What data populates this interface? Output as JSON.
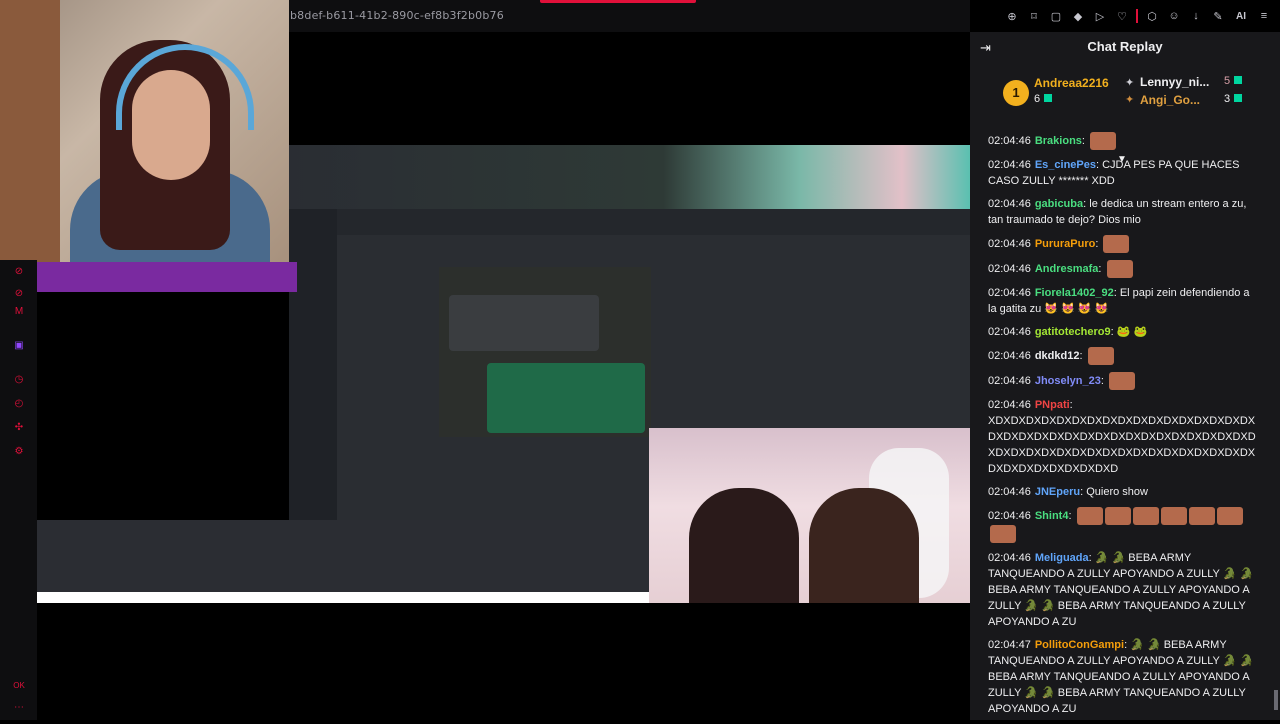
{
  "browser": {
    "url_fragment": "b8def-b611-41b2-890c-ef8b3f2b0b76",
    "toolbar_icons": [
      "zoom-icon",
      "bookmark-icon",
      "screenshot-icon",
      "shield-icon",
      "play-icon",
      "heart-icon",
      "extension-icon",
      "person-icon",
      "download-icon",
      "edit-icon",
      "ai-icon",
      "menu-icon"
    ],
    "ai_label": "AI"
  },
  "rail": {
    "icons": [
      "clip-icon",
      "clip-icon",
      "m-icon",
      "twitch-icon",
      "clock-icon",
      "history-icon",
      "puzzle-icon",
      "settings-icon"
    ],
    "bottom_label": "OK"
  },
  "chat": {
    "title": "Chat Replay",
    "leaderboard": {
      "first": {
        "rank": "1",
        "name": "Andreaa2216",
        "count": "6"
      },
      "second": {
        "name": "Lennyy_ni...",
        "count": "5"
      },
      "third": {
        "name": "Angi_Go...",
        "count": "3"
      }
    },
    "messages": [
      {
        "time": "02:04:46",
        "user": "Brakions",
        "color": "#4ade80",
        "text": "",
        "emotes": 1
      },
      {
        "time": "02:04:46",
        "user": "Es_cinePes",
        "color": "#60a5fa",
        "text": "CJDA PES PA QUE HACES CASO ZULLY ******* XDD",
        "emotes": 0
      },
      {
        "time": "02:04:46",
        "user": "gabicuba",
        "color": "#4ade80",
        "text": "le dedica un stream entero a zu, tan traumado te dejo? Dios mio",
        "emotes": 0
      },
      {
        "time": "02:04:46",
        "user": "PururaPuro",
        "color": "#f59e0b",
        "text": "",
        "emotes": 1
      },
      {
        "time": "02:04:46",
        "user": "Andresmafa",
        "color": "#4ade80",
        "text": "",
        "emotes": 1
      },
      {
        "time": "02:04:46",
        "user": "Fiorela1402_92",
        "color": "#4ade80",
        "text": "El papi zein defendiendo a la gatita zu 😻 😻 😻 😻",
        "emotes": 0
      },
      {
        "time": "02:04:46",
        "user": "gatitotechero9",
        "color": "#a3e635",
        "text": "🐸 🐸",
        "emotes": 0
      },
      {
        "time": "02:04:46",
        "user": "dkdkd12",
        "color": "#efeff1",
        "text": "",
        "emotes": 1
      },
      {
        "time": "02:04:46",
        "user": "Jhoselyn_23",
        "color": "#818cf8",
        "text": "",
        "emotes": 1
      },
      {
        "time": "02:04:46",
        "user": "PNpati",
        "color": "#ef4444",
        "text": "XDXDXDXDXDXDXDXDXDXDXDXDXDXDXDXDXDXDXDXDXDXDXDXDXDXDXDXDXDXDXDXDXDXDXDXDXDXDXDXDXDXDXDXDXDXDXDXDXDXDXDXDXDXDXDXDXDXDXDXDXD",
        "emotes": 0
      },
      {
        "time": "02:04:46",
        "user": "JNEperu",
        "color": "#60a5fa",
        "text": "Quiero show",
        "emotes": 0
      },
      {
        "time": "02:04:46",
        "user": "Shint4",
        "color": "#4ade80",
        "text": "",
        "emotes": 7
      },
      {
        "time": "02:04:46",
        "user": "Meliguada",
        "color": "#60a5fa",
        "text": "🐊 🐊 BEBA ARMY TANQUEANDO A ZULLY APOYANDO A ZULLY 🐊 🐊 BEBA ARMY TANQUEANDO A ZULLY APOYANDO A ZULLY 🐊 🐊 BEBA ARMY TANQUEANDO A ZULLY APOYANDO A ZU",
        "emotes": 0
      },
      {
        "time": "02:04:47",
        "user": "PollitoConGampi",
        "color": "#f59e0b",
        "text": "🐊 🐊 BEBA ARMY TANQUEANDO A ZULLY APOYANDO A ZULLY 🐊 🐊 BEBA ARMY TANQUEANDO A ZULLY APOYANDO A ZULLY 🐊 🐊 BEBA ARMY TANQUEANDO A ZULLY APOYANDO A ZU",
        "emotes": 0
      }
    ]
  }
}
